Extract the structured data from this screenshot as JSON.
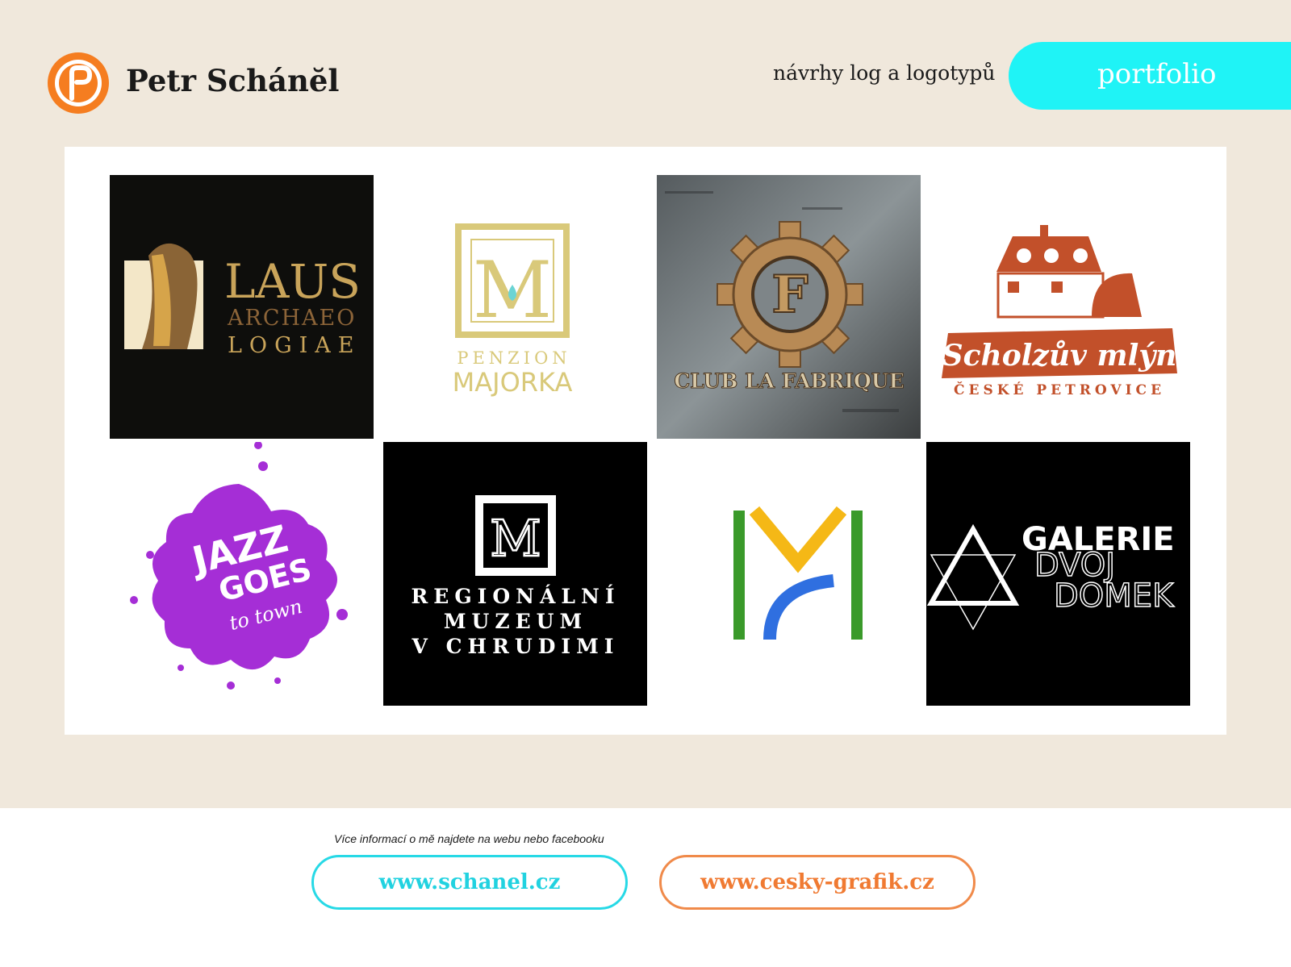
{
  "header": {
    "name": "Petr Schánĕl",
    "tagline": "návrhy log a logotypů",
    "portfolio_label": "portfolio"
  },
  "colors": {
    "cream": "#f0e8dc",
    "cyan": "#1ff3f6",
    "orange": "#f07a32",
    "purple": "#a52ed6",
    "gold": "#c9a45a"
  },
  "logos": [
    {
      "id": "laus",
      "lines": [
        "LAUS",
        "ARCHAEO",
        "LOGIAE"
      ]
    },
    {
      "id": "majorka",
      "lines": [
        "M",
        "PENZION",
        "MAJORKA"
      ]
    },
    {
      "id": "fabrique",
      "lines": [
        "F",
        "CLUB LA FABRIQUE"
      ]
    },
    {
      "id": "mlyn",
      "lines": [
        "Scholzův mlýn",
        "ČESKÉ PETROVICE"
      ]
    },
    {
      "id": "jazz",
      "lines": [
        "JAZZ",
        "GOES",
        "to town"
      ]
    },
    {
      "id": "muzeum",
      "lines": [
        "REGIONÁLNÍ",
        "MUZEUM",
        "V CHRUDIMI"
      ]
    },
    {
      "id": "mh",
      "lines": []
    },
    {
      "id": "galerie",
      "lines": [
        "GALERIE",
        "DVOJ",
        "DOMEK"
      ]
    }
  ],
  "footer": {
    "note": "Více informací o mě najdete na webu nebo facebooku",
    "link1": "www.schanel.cz",
    "link2": "www.cesky-grafik.cz"
  }
}
